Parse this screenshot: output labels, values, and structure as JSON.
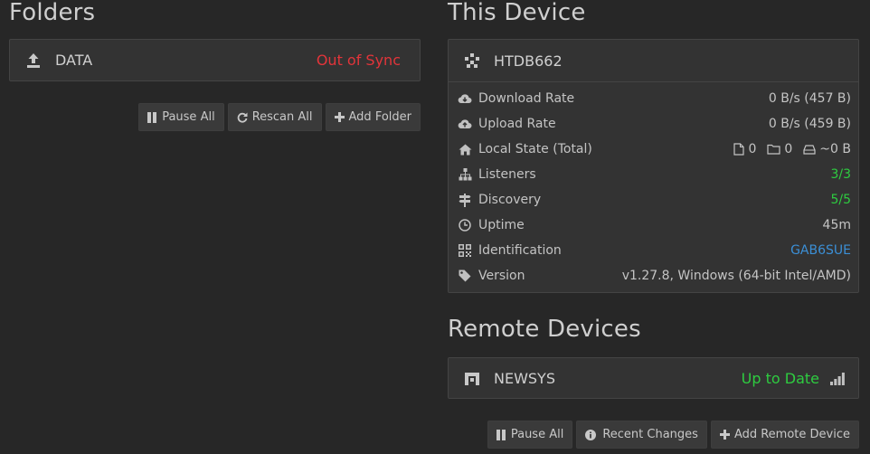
{
  "folders": {
    "title": "Folders",
    "items": [
      {
        "name": "DATA",
        "status": "Out of Sync",
        "icon": "upload-icon"
      }
    ],
    "buttons": {
      "pause_all": "Pause All",
      "rescan_all": "Rescan All",
      "add_folder": "Add Folder"
    }
  },
  "this_device": {
    "title": "This Device",
    "name": "HTDB662",
    "rows": {
      "download_rate": {
        "label": "Download Rate",
        "value": "0 B/s (457 B)"
      },
      "upload_rate": {
        "label": "Upload Rate",
        "value": "0 B/s (459 B)"
      },
      "local_state": {
        "label": "Local State (Total)",
        "files": "0",
        "dirs": "0",
        "size": "~0 B"
      },
      "listeners": {
        "label": "Listeners",
        "value": "3/3"
      },
      "discovery": {
        "label": "Discovery",
        "value": "5/5"
      },
      "uptime": {
        "label": "Uptime",
        "value": "45m"
      },
      "identification": {
        "label": "Identification",
        "value": "GAB6SUE"
      },
      "version": {
        "label": "Version",
        "value": "v1.27.8, Windows (64-bit Intel/AMD)"
      }
    }
  },
  "remote_devices": {
    "title": "Remote Devices",
    "items": [
      {
        "name": "NEWSYS",
        "status": "Up to Date"
      }
    ],
    "buttons": {
      "pause_all": "Pause All",
      "recent_changes": "Recent Changes",
      "add_remote_device": "Add Remote Device"
    }
  },
  "colors": {
    "background": "#272727",
    "panel": "#333333",
    "out_of_sync": "#e2343a",
    "up_to_date": "#2ecc40",
    "link": "#3b8fd6"
  }
}
